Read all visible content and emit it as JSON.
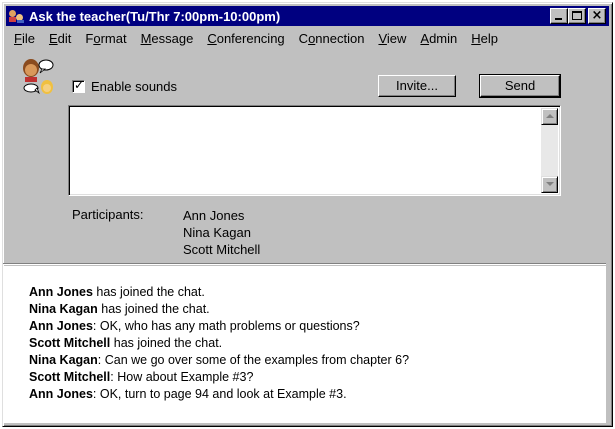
{
  "window": {
    "title": "Ask the teacher(Tu/Thr 7:00pm-10:00pm)"
  },
  "menu": [
    {
      "u": "F",
      "rest": "ile"
    },
    {
      "u": "E",
      "rest": "dit"
    },
    {
      "pre": "F",
      "u": "o",
      "rest": "rmat"
    },
    {
      "u": "M",
      "rest": "essage"
    },
    {
      "u": "C",
      "rest": "onferencing"
    },
    {
      "pre": "C",
      "u": "o",
      "rest": "nnection"
    },
    {
      "u": "V",
      "rest": "iew"
    },
    {
      "u": "A",
      "rest": "dmin"
    },
    {
      "u": "H",
      "rest": "elp"
    }
  ],
  "controls": {
    "enable_sounds_label": "Enable sounds",
    "enable_sounds_checked": true,
    "invite_label": "Invite...",
    "send_label": "Send",
    "compose_value": ""
  },
  "participants": {
    "label": "Participants:",
    "names": [
      "Ann Jones",
      "Nina Kagan",
      "Scott Mitchell"
    ]
  },
  "chat": [
    {
      "name": "Ann Jones",
      "text": " has joined the chat."
    },
    {
      "name": "Nina Kagan",
      "text": " has joined the chat."
    },
    {
      "name": "Ann Jones",
      "text": ": OK, who has any math problems or questions?"
    },
    {
      "name": "Scott Mitchell",
      "text": " has joined the chat."
    },
    {
      "name": "Nina Kagan",
      "text": ": Can we go over some of the examples from chapter 6?"
    },
    {
      "name": "Scott Mitchell",
      "text": ": How about Example #3?"
    },
    {
      "name": "Ann Jones",
      "text": ": OK, turn to page 94 and look at Example #3."
    }
  ],
  "colors": {
    "titlebar": "#000080",
    "face": "#c0c0c0"
  }
}
